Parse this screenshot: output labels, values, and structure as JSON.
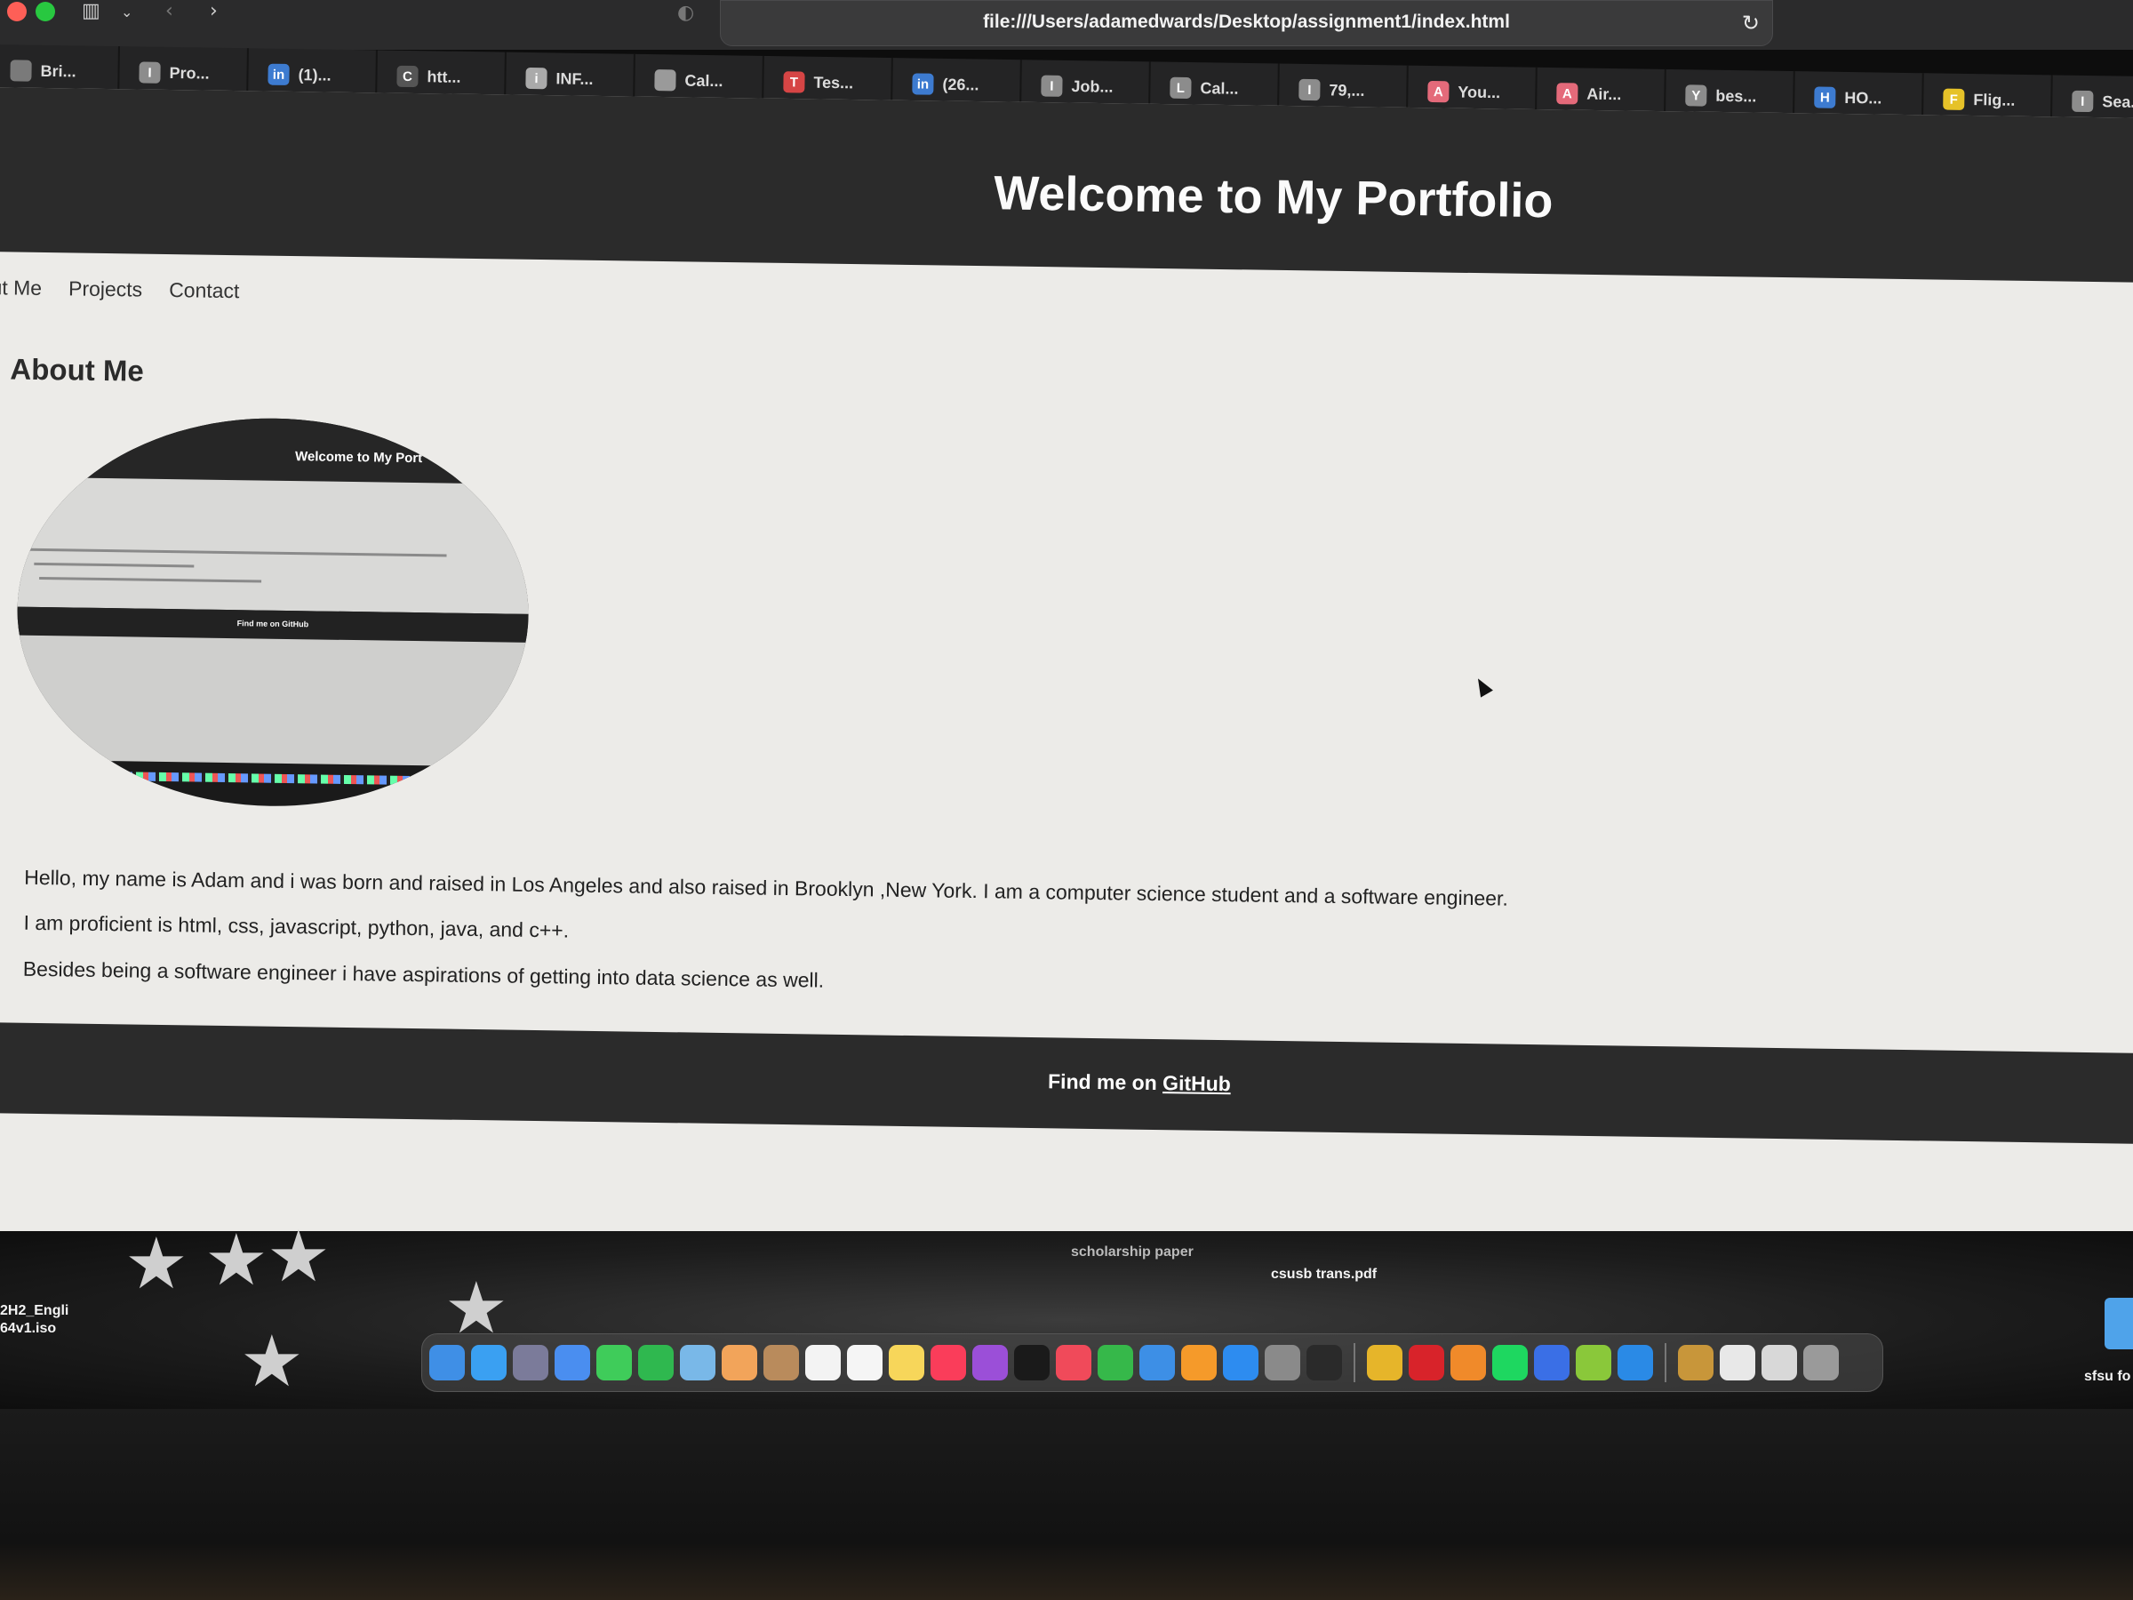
{
  "browser": {
    "url": "file:///Users/adamedwards/Desktop/assignment1/index.html",
    "tabs": [
      {
        "label": "Bri...",
        "icon_letter": "",
        "icon": "doc-icon",
        "color": "#7a7a7a"
      },
      {
        "label": "Pro...",
        "icon_letter": "I",
        "icon": "indeed-icon",
        "color": "#8c8c8c"
      },
      {
        "label": "(1)...",
        "icon_letter": "in",
        "icon": "linkedin-icon",
        "color": "#3d7bd0"
      },
      {
        "label": "htt...",
        "icon_letter": "C",
        "icon": "code-icon",
        "color": "#555555"
      },
      {
        "label": "INF...",
        "icon_letter": "i",
        "icon": "info-icon",
        "color": "#aaaaaa"
      },
      {
        "label": "Cal...",
        "icon_letter": "",
        "icon": "calendar-icon",
        "color": "#9a9a9a"
      },
      {
        "label": "Tes...",
        "icon_letter": "T",
        "icon": "tesla-icon",
        "color": "#d64545"
      },
      {
        "label": "(26...",
        "icon_letter": "in",
        "icon": "linkedin-icon",
        "color": "#3d7bd0"
      },
      {
        "label": "Job...",
        "icon_letter": "I",
        "icon": "indeed-icon",
        "color": "#8c8c8c"
      },
      {
        "label": "Cal...",
        "icon_letter": "L",
        "icon": "calendar-icon",
        "color": "#8c8c8c"
      },
      {
        "label": "79,...",
        "icon_letter": "I",
        "icon": "indeed-icon",
        "color": "#8c8c8c"
      },
      {
        "label": "You...",
        "icon_letter": "A",
        "icon": "airbnb-icon",
        "color": "#e46a7a"
      },
      {
        "label": "Air...",
        "icon_letter": "A",
        "icon": "airbnb-icon",
        "color": "#e46a7a"
      },
      {
        "label": "bes...",
        "icon_letter": "Y",
        "icon": "yahoo-icon",
        "color": "#8c8c8c"
      },
      {
        "label": "HO...",
        "icon_letter": "H",
        "icon": "hotel-icon",
        "color": "#3d7bd0"
      },
      {
        "label": "Flig...",
        "icon_letter": "F",
        "icon": "flight-icon",
        "color": "#e6c229"
      },
      {
        "label": "Sea...",
        "icon_letter": "I",
        "icon": "indeed-icon",
        "color": "#8c8c8c"
      }
    ]
  },
  "page": {
    "header_title": "Welcome to My Portfolio",
    "nav": [
      "out Me",
      "Projects",
      "Contact"
    ],
    "section_title": "About Me",
    "image_mini_title": "Welcome to My Port",
    "image_mini_footer": "Find me on GitHub",
    "paragraphs": [
      "Hello, my name is Adam and i was born and raised in Los Angeles and also raised in Brooklyn ,New York. I am a computer science student and a software engineer.",
      "I am proficient is html, css, javascript, python, java, and c++.",
      "Besides being a software engineer i have aspirations of getting into data science as well."
    ],
    "footer_prefix": "Find me on ",
    "footer_link": "GitHub"
  },
  "desktop": {
    "file_scholarship": "scholarship paper",
    "file_csusb": "csusb trans.pdf",
    "file_iso_line1": "2H2_Engli",
    "file_iso_line2": "64v1.iso",
    "file_sfsu": "sfsu fo"
  },
  "dock": {
    "apps": [
      {
        "name": "finder-icon",
        "color": "#3f8fe6"
      },
      {
        "name": "safari-icon",
        "color": "#3aa0f2"
      },
      {
        "name": "launchpad-icon",
        "color": "#7b7b9a"
      },
      {
        "name": "mail-icon",
        "color": "#4a8ef0"
      },
      {
        "name": "messages-icon",
        "color": "#3fcc5a"
      },
      {
        "name": "facetime-icon",
        "color": "#2fb84f"
      },
      {
        "name": "maps-icon",
        "color": "#79b8e8"
      },
      {
        "name": "photos-icon",
        "color": "#f2a45a"
      },
      {
        "name": "contacts-icon",
        "color": "#b98b5c"
      },
      {
        "name": "calendar-icon",
        "color": "#f3f3f3"
      },
      {
        "name": "reminders-icon",
        "color": "#f5f5f5"
      },
      {
        "name": "notes-icon",
        "color": "#f7d65a"
      },
      {
        "name": "music-icon",
        "color": "#fa3d5a"
      },
      {
        "name": "podcasts-icon",
        "color": "#9b4fd8"
      },
      {
        "name": "tv-icon",
        "color": "#1a1a1a"
      },
      {
        "name": "news-icon",
        "color": "#f04a5a"
      },
      {
        "name": "numbers-icon",
        "color": "#36b84a"
      },
      {
        "name": "keynote-icon",
        "color": "#3d8fe6"
      },
      {
        "name": "pages-icon",
        "color": "#f59a2a"
      },
      {
        "name": "appstore-icon",
        "color": "#2d8cf0"
      },
      {
        "name": "settings-icon",
        "color": "#8a8a8a"
      },
      {
        "name": "terminal-icon",
        "color": "#2a2a2a"
      },
      {
        "name": "chrome-icon",
        "color": "#e6b52a"
      },
      {
        "name": "acrobat-icon",
        "color": "#d8232a"
      },
      {
        "name": "sublime-icon",
        "color": "#f08a2a"
      },
      {
        "name": "spotify-icon",
        "color": "#1ed760"
      },
      {
        "name": "webex-icon",
        "color": "#3a6fe6"
      },
      {
        "name": "whatsapp-icon",
        "color": "#8ac83a"
      },
      {
        "name": "vscode-icon",
        "color": "#2a8ae6"
      },
      {
        "name": "archive-icon",
        "color": "#c8963a"
      },
      {
        "name": "document-icon",
        "color": "#e8e8e8"
      },
      {
        "name": "downloads-icon",
        "color": "#d8d8d8"
      },
      {
        "name": "trash-icon",
        "color": "#9a9a9a"
      }
    ]
  }
}
